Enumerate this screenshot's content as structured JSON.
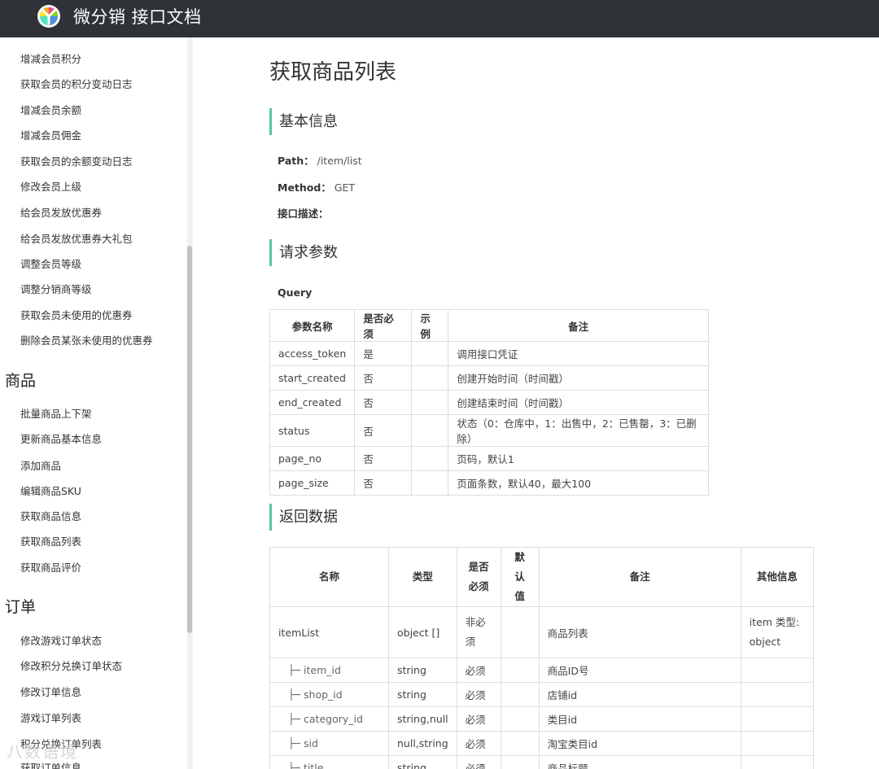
{
  "header": {
    "app_title": "微分销 接口文档"
  },
  "sidebar": {
    "member_items": [
      "增减会员积分",
      "获取会员的积分变动日志",
      "增减会员余额",
      "增减会员佣金",
      "获取会员的余额变动日志",
      "修改会员上级",
      "给会员发放优惠券",
      "给会员发放优惠券大礼包",
      "调整会员等级",
      "调整分销商等级",
      "获取会员未使用的优惠券",
      "删除会员某张未使用的优惠券"
    ],
    "goods_group": "商品",
    "goods_items": [
      "批量商品上下架",
      "更新商品基本信息",
      "添加商品",
      "编辑商品SKU",
      "获取商品信息",
      "获取商品列表",
      "获取商品评价"
    ],
    "order_group": "订单",
    "order_items": [
      "修改游戏订单状态",
      "修改积分兑换订单状态",
      "修改订单信息",
      "游戏订单列表",
      "积分兑换订单列表",
      "获取订单信息"
    ]
  },
  "main": {
    "title": "获取商品列表",
    "basic": {
      "heading": "基本信息",
      "path_label": "Path：",
      "path_value": "/item/list",
      "method_label": "Method：",
      "method_value": "GET",
      "desc_label": "接口描述："
    },
    "request": {
      "heading": "请求参数",
      "query_label": "Query",
      "columns": [
        "参数名称",
        "是否必须",
        "示例",
        "备注"
      ],
      "rows": [
        [
          "access_token",
          "是",
          "",
          "调用接口凭证"
        ],
        [
          "start_created",
          "否",
          "",
          "创建开始时间（时间戳）"
        ],
        [
          "end_created",
          "否",
          "",
          "创建结束时间（时间戳）"
        ],
        [
          "status",
          "否",
          "",
          "状态（0：仓库中，1：出售中，2：已售罄，3：已删除）"
        ],
        [
          "page_no",
          "否",
          "",
          "页码，默认1"
        ],
        [
          "page_size",
          "否",
          "",
          "页面条数，默认40，最大100"
        ]
      ]
    },
    "response": {
      "heading": "返回数据",
      "columns": [
        "名称",
        "类型",
        "是否必须",
        "默认值",
        "备注",
        "其他信息"
      ],
      "rows": [
        [
          "itemList",
          "object []",
          "非必须",
          "",
          "商品列表",
          "item 类型: object"
        ],
        [
          "├─ item_id",
          "string",
          "必须",
          "",
          "商品ID号",
          ""
        ],
        [
          "├─ shop_id",
          "string",
          "必须",
          "",
          "店铺id",
          ""
        ],
        [
          "├─ category_id",
          "string,null",
          "必须",
          "",
          "类目id",
          ""
        ],
        [
          "├─ sid",
          "null,string",
          "必须",
          "",
          "淘宝类目id",
          ""
        ],
        [
          "├─ title",
          "string",
          "必须",
          "",
          "商品标题",
          ""
        ]
      ]
    }
  },
  "watermark": "八数语境"
}
